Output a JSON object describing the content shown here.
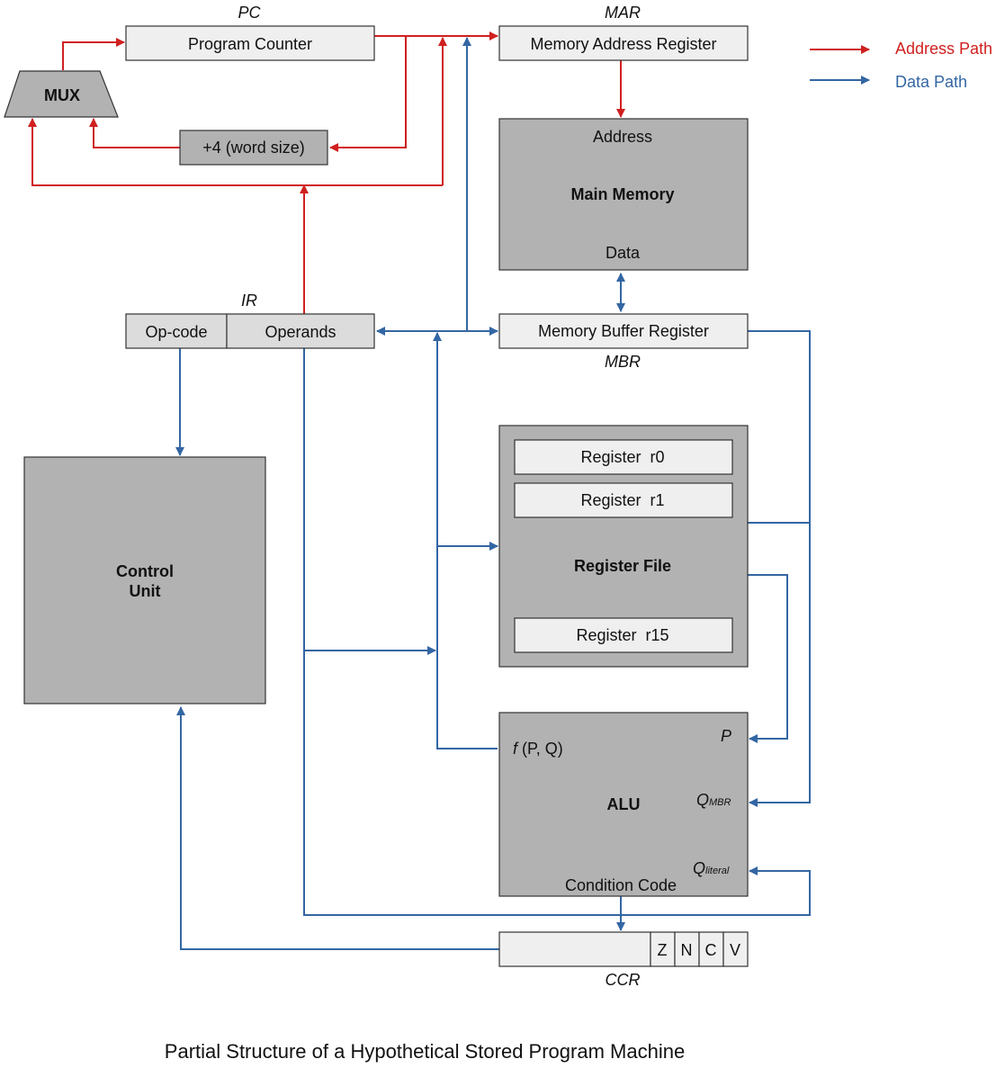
{
  "diagram": {
    "caption": "Partial Structure of a Hypothetical Stored Program Machine",
    "colors": {
      "address_path": "#d02020",
      "data_path": "#3366a3",
      "dark_block": "#b2b2b2",
      "light_block": "#efefef"
    },
    "legend": {
      "address_path": "Address Path",
      "data_path": "Data Path"
    },
    "pc": {
      "tag": "PC",
      "label": "Program Counter"
    },
    "mar": {
      "tag": "MAR",
      "label": "Memory Address Register"
    },
    "mux": {
      "label": "MUX"
    },
    "incrementer": {
      "label": "+4 (word size)"
    },
    "main_memory": {
      "label": "Main Memory",
      "address_port": "Address",
      "data_port": "Data"
    },
    "ir": {
      "tag": "IR",
      "opcode": "Op-code",
      "operands": "Operands"
    },
    "mbr": {
      "tag": "MBR",
      "label": "Memory Buffer Register"
    },
    "control_unit": {
      "line1": "Control",
      "line2": "Unit"
    },
    "register_file": {
      "label": "Register File",
      "registers": [
        "Register  r0",
        "Register  r1",
        "Register  r15"
      ]
    },
    "alu": {
      "label": "ALU",
      "function_f": "f",
      "function_args": " (P, Q)",
      "input_p": "P",
      "input_qmbr_q": "Q",
      "input_qmbr_sub": "MBR",
      "input_qlit_q": "Q",
      "input_qlit_sub": "literal",
      "condition_code": "Condition Code"
    },
    "ccr": {
      "tag": "CCR",
      "flags": [
        "Z",
        "N",
        "C",
        "V"
      ]
    }
  }
}
